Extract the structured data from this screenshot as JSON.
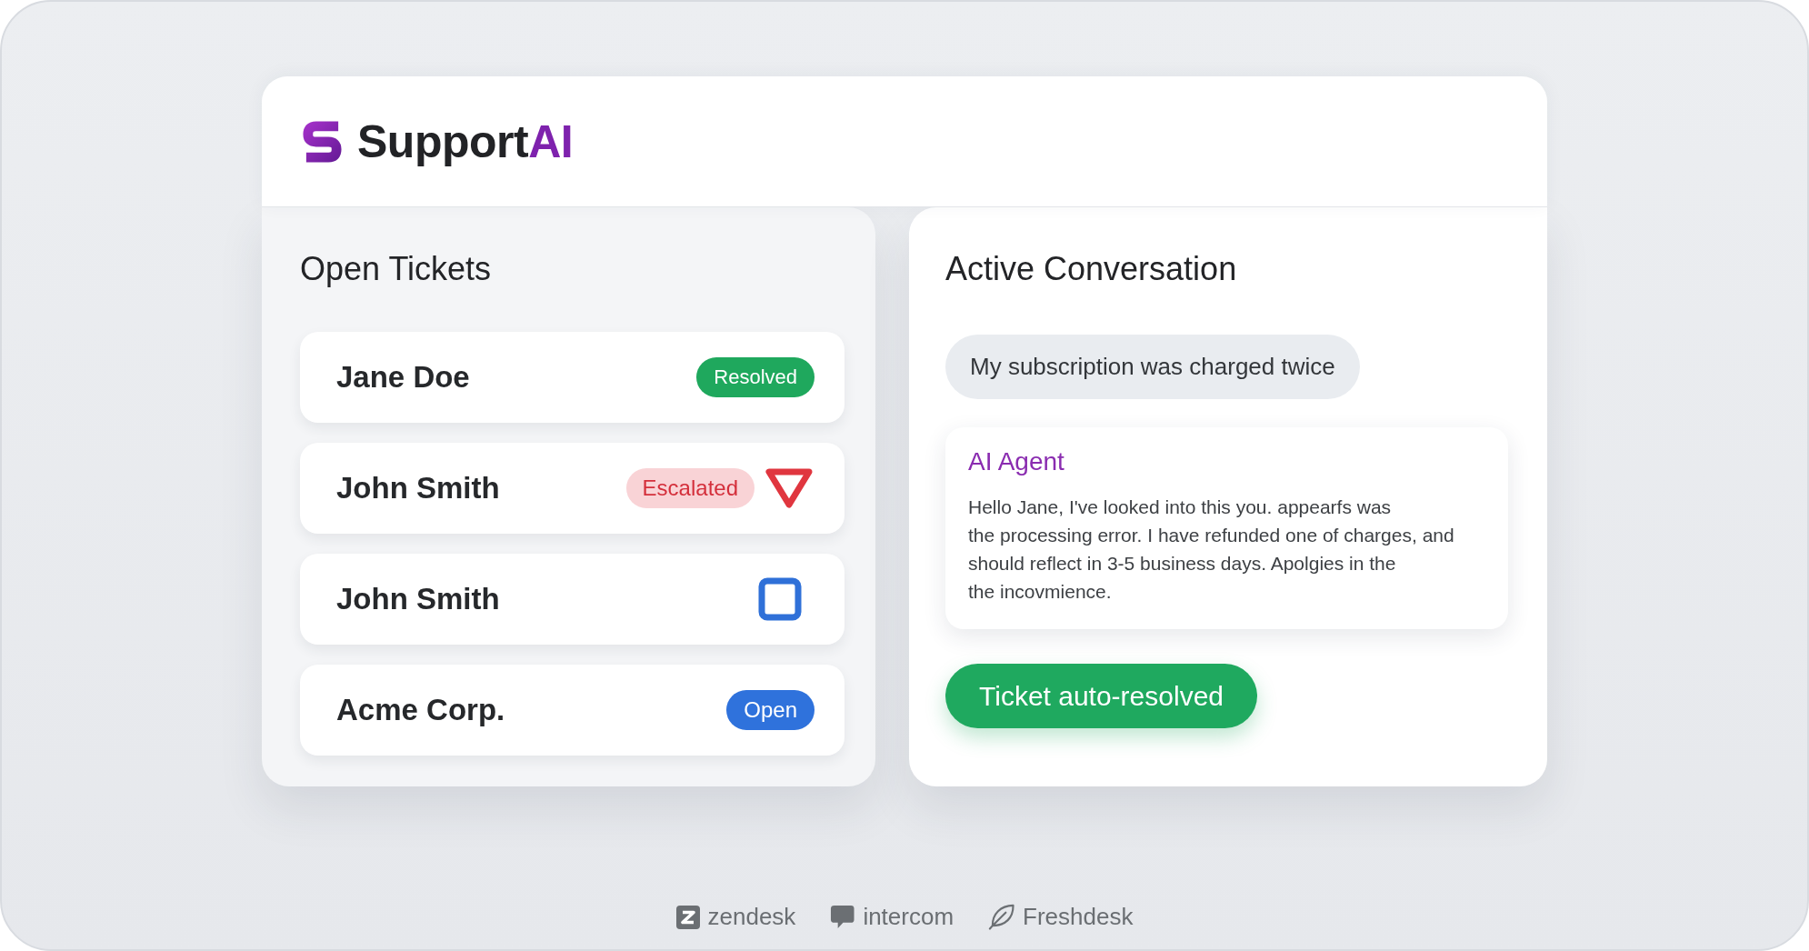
{
  "brand": {
    "name": "Support",
    "accent": "AI"
  },
  "tickets_panel": {
    "title": "Open Tickets",
    "tickets": [
      {
        "name": "Jane Doe",
        "kind": "resolved",
        "badge": "Resolved"
      },
      {
        "name": "John Smith",
        "kind": "escalated",
        "badge": "Escalated"
      },
      {
        "name": "John Smith",
        "kind": "square"
      },
      {
        "name": "Acme Corp.",
        "kind": "open",
        "badge": "Open"
      }
    ]
  },
  "conversation": {
    "title": "Active Conversation",
    "customer_message": "My subscription was charged twice",
    "agent_reply": {
      "sender": "AI Agent",
      "lines": [
        "Hello Jane, I've looked into this you. appearfs was",
        "the processing error. I have refunded one of charges, and",
        "should reflect in 3-5 business days. Apolgies in the",
        "the incovmience."
      ]
    },
    "action": "Ticket auto-resolved"
  },
  "integrations": [
    {
      "name": "zendesk",
      "kind": "tile"
    },
    {
      "name": "intercom",
      "kind": "bubble"
    },
    {
      "name": "Freshdesk",
      "kind": "leaf"
    }
  ]
}
